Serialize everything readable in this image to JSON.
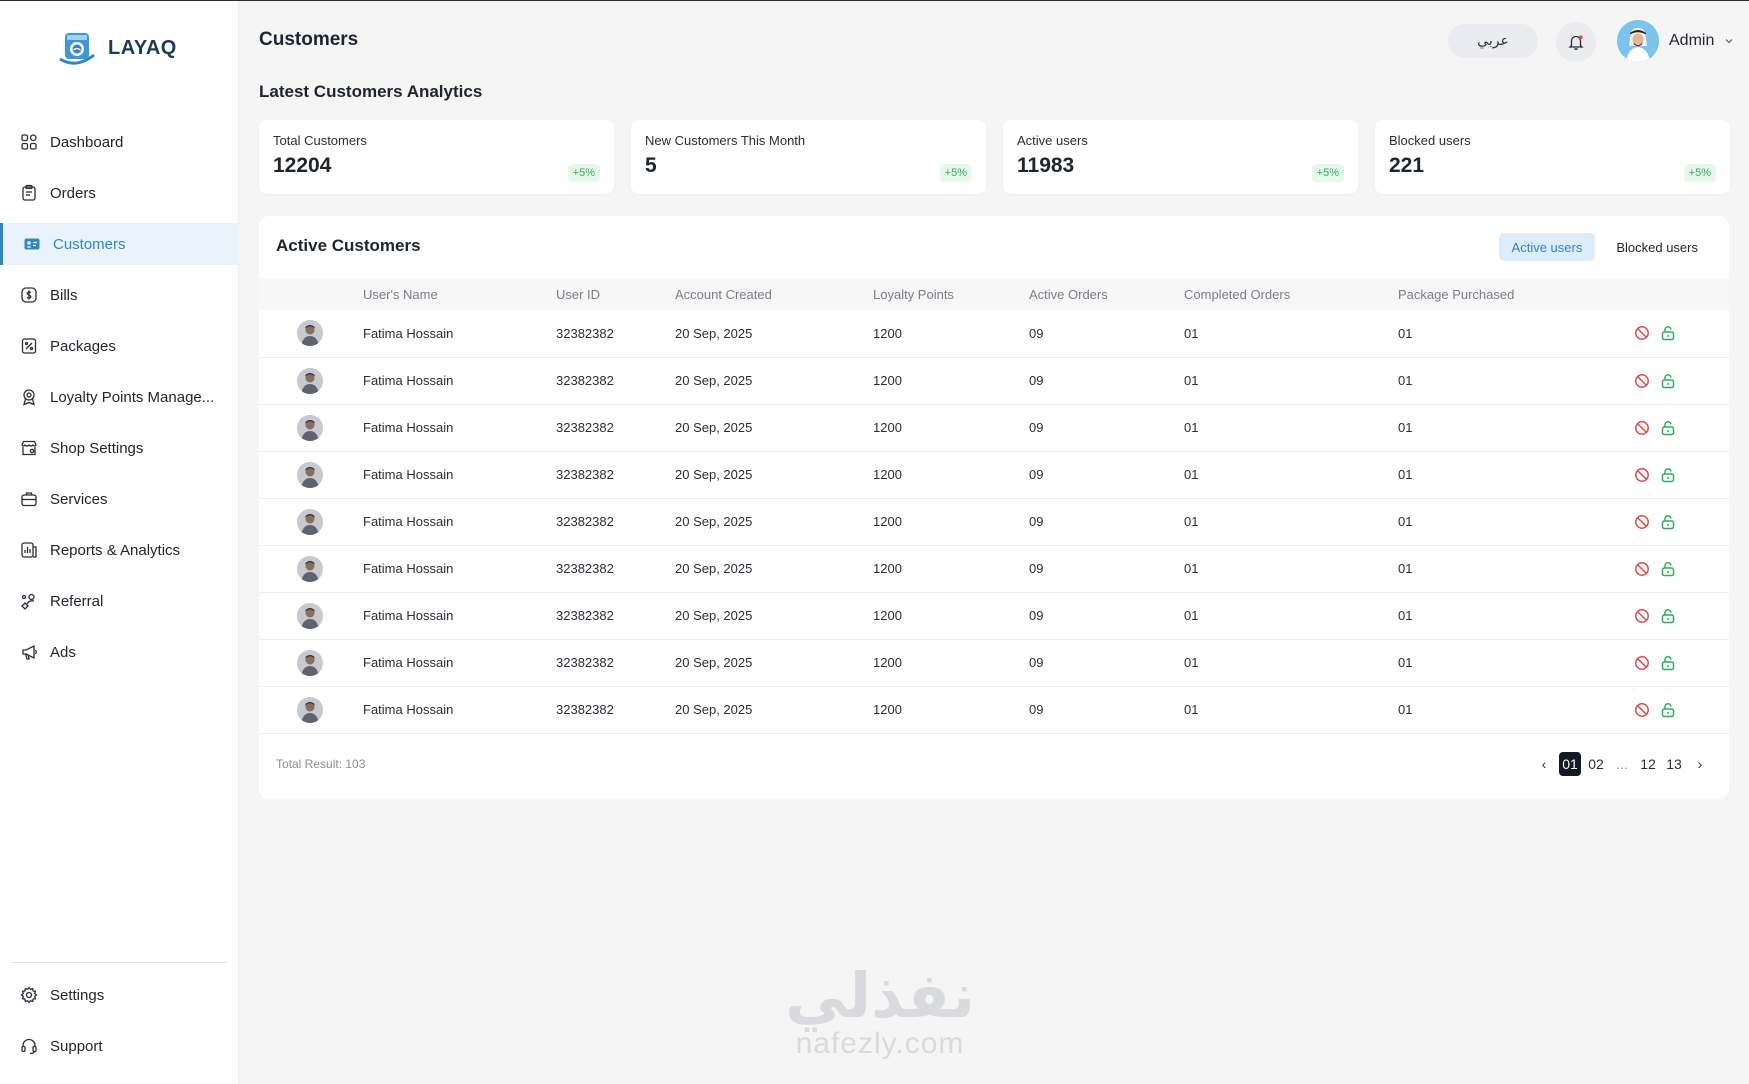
{
  "app": {
    "name": "LAYAQ"
  },
  "sidebar": {
    "items": [
      {
        "label": "Dashboard",
        "icon": "grid-icon"
      },
      {
        "label": "Orders",
        "icon": "clipboard-icon"
      },
      {
        "label": "Customers",
        "icon": "id-card-icon",
        "active": true
      },
      {
        "label": "Bills",
        "icon": "dollar-icon"
      },
      {
        "label": "Packages",
        "icon": "percent-tag-icon"
      },
      {
        "label": "Loyalty Points Manage...",
        "icon": "badge-icon"
      },
      {
        "label": "Shop Settings",
        "icon": "shop-icon"
      },
      {
        "label": "Services",
        "icon": "briefcase-icon"
      },
      {
        "label": "Reports & Analytics",
        "icon": "report-icon"
      },
      {
        "label": "Referral",
        "icon": "referral-icon"
      },
      {
        "label": "Ads",
        "icon": "megaphone-icon"
      }
    ],
    "bottom_items": [
      {
        "label": "Settings",
        "icon": "gear-icon"
      },
      {
        "label": "Support",
        "icon": "headset-icon"
      }
    ]
  },
  "header": {
    "title": "Customers",
    "language_button": "عربي",
    "user_name": "Admin"
  },
  "analytics": {
    "title": "Latest Customers Analytics",
    "cards": [
      {
        "label": "Total Customers",
        "value": "12204",
        "change": "+5%"
      },
      {
        "label": "New Customers This Month",
        "value": "5",
        "change": "+5%"
      },
      {
        "label": "Active users",
        "value": "11983",
        "change": "+5%"
      },
      {
        "label": "Blocked users",
        "value": "221",
        "change": "+5%"
      }
    ]
  },
  "table": {
    "title": "Active Customers",
    "filters": [
      "Active users",
      "Blocked users"
    ],
    "active_filter": "Active users",
    "columns": [
      "User's Name",
      "User ID",
      "Account Created",
      "Loyalty Points",
      "Active Orders",
      "Completed Orders",
      "Package Purchased"
    ],
    "rows": [
      {
        "name": "Fatima Hossain",
        "id": "32382382",
        "created": "20 Sep, 2025",
        "points": "1200",
        "active_orders": "09",
        "completed_orders": "01",
        "package": "01"
      },
      {
        "name": "Fatima Hossain",
        "id": "32382382",
        "created": "20 Sep, 2025",
        "points": "1200",
        "active_orders": "09",
        "completed_orders": "01",
        "package": "01"
      },
      {
        "name": "Fatima Hossain",
        "id": "32382382",
        "created": "20 Sep, 2025",
        "points": "1200",
        "active_orders": "09",
        "completed_orders": "01",
        "package": "01"
      },
      {
        "name": "Fatima Hossain",
        "id": "32382382",
        "created": "20 Sep, 2025",
        "points": "1200",
        "active_orders": "09",
        "completed_orders": "01",
        "package": "01"
      },
      {
        "name": "Fatima Hossain",
        "id": "32382382",
        "created": "20 Sep, 2025",
        "points": "1200",
        "active_orders": "09",
        "completed_orders": "01",
        "package": "01"
      },
      {
        "name": "Fatima Hossain",
        "id": "32382382",
        "created": "20 Sep, 2025",
        "points": "1200",
        "active_orders": "09",
        "completed_orders": "01",
        "package": "01"
      },
      {
        "name": "Fatima Hossain",
        "id": "32382382",
        "created": "20 Sep, 2025",
        "points": "1200",
        "active_orders": "09",
        "completed_orders": "01",
        "package": "01"
      },
      {
        "name": "Fatima Hossain",
        "id": "32382382",
        "created": "20 Sep, 2025",
        "points": "1200",
        "active_orders": "09",
        "completed_orders": "01",
        "package": "01"
      },
      {
        "name": "Fatima Hossain",
        "id": "32382382",
        "created": "20 Sep, 2025",
        "points": "1200",
        "active_orders": "09",
        "completed_orders": "01",
        "package": "01"
      }
    ],
    "total_label": "Total Result: 103",
    "pagination": {
      "pages": [
        "01",
        "02",
        "...",
        "12",
        "13"
      ],
      "current": "01",
      "prev": "‹",
      "next": "›"
    }
  },
  "watermark": {
    "arabic": "نفذلي",
    "latin": "nafezly.com"
  },
  "colors": {
    "accent": "#2f86c8",
    "active_bg": "#eaf3fb",
    "success": "#2fae5a",
    "danger": "#e0474c",
    "brand": "#1c3a5e"
  }
}
